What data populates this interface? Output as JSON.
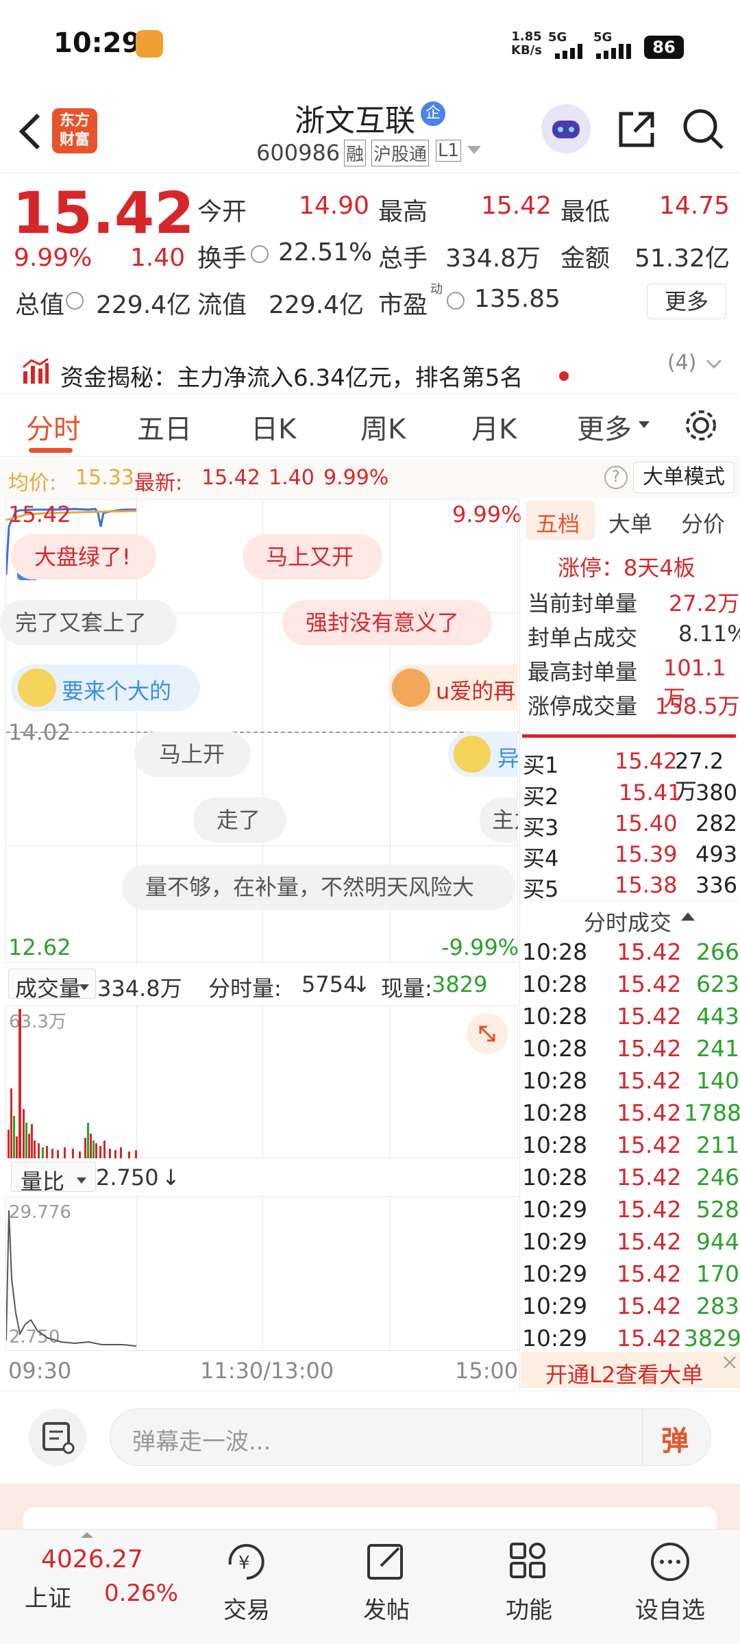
{
  "status_bar": {
    "time": "10:29",
    "net_speed": "1.85",
    "net_unit": "KB/s",
    "sig1": "5G",
    "sig2": "5G",
    "battery": "86"
  },
  "nav": {
    "logo_line1": "东方",
    "logo_line2": "财富",
    "title": "浙文互联",
    "badge": "企",
    "code": "600986",
    "tag_rong": "融",
    "tag_hgt": "沪股通",
    "tag_l1": "L1"
  },
  "quote": {
    "price": "15.42",
    "pct": "9.99%",
    "chg": "1.40",
    "open_label": "今开",
    "open": "14.90",
    "high_label": "最高",
    "high": "15.42",
    "low_label": "最低",
    "low": "14.75",
    "turnover_label": "换手",
    "turnover": "22.51%",
    "volume_label": "总手",
    "volume": "334.8万",
    "amount_label": "金额",
    "amount": "51.32亿",
    "mktcap_label": "总值",
    "mktcap": "229.4亿",
    "float_label": "流值",
    "float": "229.4亿",
    "pe_label": "市盈",
    "pe_sup": "动",
    "pe": "135.85",
    "more": "更多"
  },
  "fund_flow": {
    "text": "资金揭秘：主力净流入6.34亿元，排名第5名",
    "count": "(4)"
  },
  "tabs": [
    "分时",
    "五日",
    "日K",
    "周K",
    "月K",
    "更多"
  ],
  "info_line": {
    "avg_label": "均价:",
    "avg": "15.33",
    "latest_label": "最新:",
    "latest": "15.42",
    "chg": "1.40",
    "pct": "9.99%",
    "big_order": "大单模式"
  },
  "chart_labels": {
    "top_price": "15.42",
    "top_pct": "9.99%",
    "mid_price": "14.02",
    "bot_price": "12.62",
    "bot_pct": "-9.99%"
  },
  "danmu": [
    "大盘绿了!",
    "马上又开",
    "完了又套上了",
    "强封没有意义了",
    "要来个大的",
    "u爱的再",
    "马上开",
    "异",
    "走了",
    "主力",
    "量不够，在补量，不然明天风险大"
  ],
  "volume_bar": {
    "label": "成交量",
    "value": "334.8万",
    "period_label": "分时量:",
    "period_value": "5754",
    "arrow": "↓",
    "now_label": "现量:",
    "now_value": "3829",
    "max": "63.3万"
  },
  "ratio_bar": {
    "label": "量比",
    "value": "2.750",
    "arrow": "↓",
    "max": "29.776",
    "min": "2.750"
  },
  "time_axis": [
    "09:30",
    "11:30/13:00",
    "15:00"
  ],
  "right_tabs": [
    "五档",
    "大单",
    "分价"
  ],
  "limit_info": {
    "title": "涨停：8天4板",
    "rows": [
      {
        "label": "当前封单量",
        "value": "27.2万"
      },
      {
        "label": "封单占成交",
        "value": "8.11%"
      },
      {
        "label": "最高封单量",
        "value": "101.1万"
      },
      {
        "label": "涨停成交量",
        "value": "158.5万"
      }
    ]
  },
  "depth": [
    {
      "label": "买1",
      "price": "15.42",
      "vol": "27.2万"
    },
    {
      "label": "买2",
      "price": "15.41",
      "vol": "380"
    },
    {
      "label": "买3",
      "price": "15.40",
      "vol": "282"
    },
    {
      "label": "买4",
      "price": "15.39",
      "vol": "493"
    },
    {
      "label": "买5",
      "price": "15.38",
      "vol": "336"
    }
  ],
  "ticks_title": "分时成交",
  "ticks": [
    {
      "t": "10:28",
      "p": "15.42",
      "v": "266"
    },
    {
      "t": "10:28",
      "p": "15.42",
      "v": "623"
    },
    {
      "t": "10:28",
      "p": "15.42",
      "v": "443"
    },
    {
      "t": "10:28",
      "p": "15.42",
      "v": "241"
    },
    {
      "t": "10:28",
      "p": "15.42",
      "v": "140"
    },
    {
      "t": "10:28",
      "p": "15.42",
      "v": "1788"
    },
    {
      "t": "10:28",
      "p": "15.42",
      "v": "211"
    },
    {
      "t": "10:28",
      "p": "15.42",
      "v": "246"
    },
    {
      "t": "10:29",
      "p": "15.42",
      "v": "528"
    },
    {
      "t": "10:29",
      "p": "15.42",
      "v": "944"
    },
    {
      "t": "10:29",
      "p": "15.42",
      "v": "170"
    },
    {
      "t": "10:29",
      "p": "15.42",
      "v": "283"
    },
    {
      "t": "10:29",
      "p": "15.42",
      "v": "3829"
    }
  ],
  "l2_banner": "开通L2查看大单",
  "danmu_input": {
    "placeholder": "弹幕走一波...",
    "send": "弹"
  },
  "bottom": {
    "index_value": "4026.27",
    "index_name": "上证",
    "index_pct": "0.26%",
    "items": [
      "交易",
      "发帖",
      "功能",
      "设自选"
    ]
  },
  "colors": {
    "up": "#d7262a",
    "down": "#2ba12b",
    "avg_line": "#e8a83a",
    "accent": "#e8532b"
  }
}
